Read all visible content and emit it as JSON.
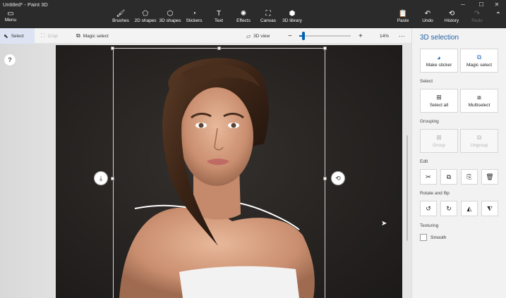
{
  "window": {
    "title": "Untitled* - Paint 3D",
    "minimize": "─",
    "maximize": "☐",
    "close": "✕"
  },
  "ribbon": {
    "menu": "Menu",
    "tools": [
      {
        "label": "Brushes",
        "icon": "brush-icon",
        "glyph": "🖌"
      },
      {
        "label": "2D shapes",
        "icon": "2d-shapes-icon",
        "glyph": "⬠"
      },
      {
        "label": "3D shapes",
        "icon": "3d-shapes-icon",
        "glyph": "⬡"
      },
      {
        "label": "Stickers",
        "icon": "stickers-icon",
        "glyph": "◔"
      },
      {
        "label": "Text",
        "icon": "text-icon",
        "glyph": "T"
      },
      {
        "label": "Effects",
        "icon": "effects-icon",
        "glyph": "✺"
      },
      {
        "label": "Canvas",
        "icon": "canvas-icon",
        "glyph": "⛶"
      },
      {
        "label": "3D library",
        "icon": "3d-library-icon",
        "glyph": "⬢"
      }
    ],
    "right_tools": [
      {
        "label": "Paste",
        "icon": "paste-icon",
        "glyph": "📋"
      },
      {
        "label": "Undo",
        "icon": "undo-icon",
        "glyph": "↶"
      },
      {
        "label": "History",
        "icon": "history-icon",
        "glyph": "⟲"
      },
      {
        "label": "Redo",
        "icon": "redo-icon",
        "glyph": "↷"
      }
    ],
    "collapse": "⌃"
  },
  "toolbar": {
    "select": "Select",
    "crop": "Crop",
    "magic_select": "Magic select",
    "view_3d": "3D view",
    "zoom_out": "−",
    "zoom_in": "+",
    "zoom_level": "14%",
    "more": "···"
  },
  "canvas": {
    "help": "?"
  },
  "panel": {
    "title": "3D selection",
    "make_sticker": "Make sticker",
    "magic_select": "Magic select",
    "select_section": "Select",
    "select_all": "Select all",
    "multiselect": "Multiselect",
    "grouping_section": "Grouping",
    "group": "Group",
    "ungroup": "Ungroup",
    "edit_section": "Edit",
    "rotate_section": "Rotate and flip",
    "texturing_section": "Texturing",
    "smooth": "Smooth"
  },
  "colors": {
    "accent": "#0063b1",
    "ribbon_bg": "#2b2b2b",
    "panel_title": "#1f5fa8"
  }
}
